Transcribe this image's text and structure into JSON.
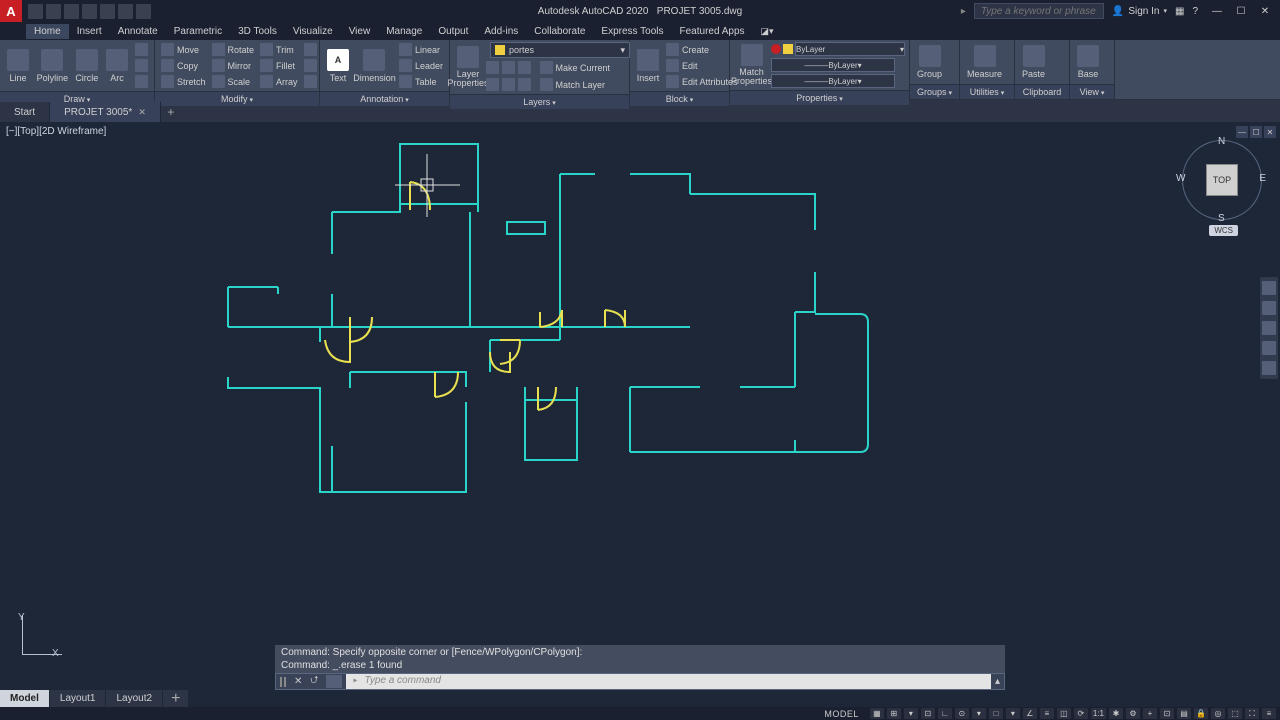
{
  "app": {
    "logo": "A",
    "title_prefix": "Autodesk AutoCAD 2020",
    "document": "PROJET 3005.dwg",
    "search_placeholder": "Type a keyword or phrase",
    "signin": "Sign In"
  },
  "menus": [
    "Home",
    "Insert",
    "Annotate",
    "Parametric",
    "3D Tools",
    "Visualize",
    "View",
    "Manage",
    "Output",
    "Add-ins",
    "Collaborate",
    "Express Tools",
    "Featured Apps"
  ],
  "active_menu": 0,
  "ribbon": {
    "draw": {
      "title": "Draw",
      "line": "Line",
      "polyline": "Polyline",
      "circle": "Circle",
      "arc": "Arc"
    },
    "modify": {
      "title": "Modify",
      "move": "Move",
      "rotate": "Rotate",
      "trim": "Trim",
      "copy": "Copy",
      "mirror": "Mirror",
      "fillet": "Fillet",
      "stretch": "Stretch",
      "scale": "Scale",
      "array": "Array"
    },
    "annotation": {
      "title": "Annotation",
      "text": "Text",
      "dimension": "Dimension",
      "linear": "Linear",
      "leader": "Leader",
      "table": "Table"
    },
    "layers": {
      "title": "Layers",
      "props": "Layer\nProperties",
      "current": "portes",
      "make_current": "Make Current",
      "match": "Match Layer"
    },
    "block": {
      "title": "Block",
      "insert": "Insert",
      "create": "Create",
      "edit": "Edit",
      "edit_attr": "Edit Attributes"
    },
    "properties": {
      "title": "Properties",
      "match": "Match\nProperties",
      "bylayer": "ByLayer"
    },
    "groups": {
      "title": "Groups",
      "group": "Group"
    },
    "utilities": {
      "title": "Utilities",
      "measure": "Measure"
    },
    "clipboard": {
      "title": "Clipboard",
      "paste": "Paste"
    },
    "view": {
      "title": "View",
      "base": "Base"
    }
  },
  "tabs": {
    "start": "Start",
    "file": "PROJET 3005*"
  },
  "viewport": {
    "label": "[−][Top][2D Wireframe]",
    "cube_face": "TOP",
    "wcs": "WCS",
    "dirs": {
      "n": "N",
      "s": "S",
      "e": "E",
      "w": "W"
    },
    "axis_y": "Y",
    "axis_x": "X"
  },
  "cmd": {
    "hist1": "Command: Specify opposite corner or [Fence/WPolygon/CPolygon]:",
    "hist2": "Command: _.erase 1 found",
    "placeholder": "Type a command"
  },
  "layouts": [
    "Model",
    "Layout1",
    "Layout2"
  ],
  "status": {
    "model": "MODEL",
    "scale": "1:1"
  },
  "colors": {
    "wall": "#2bd4c8",
    "door": "#e8e050"
  }
}
